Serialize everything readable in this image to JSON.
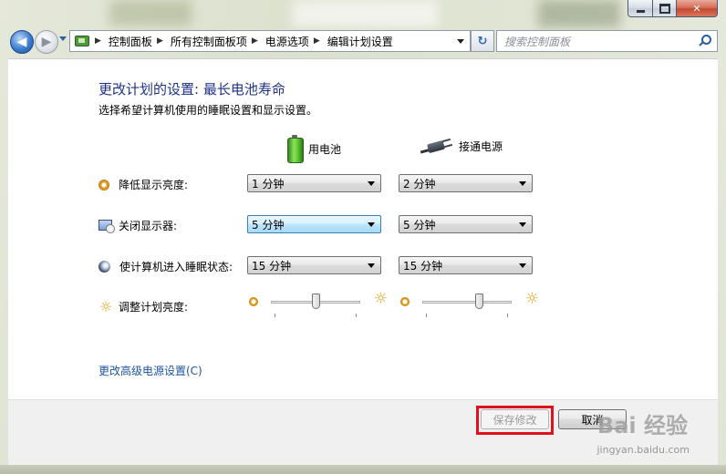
{
  "window": {
    "minimize_label": "",
    "maximize_label": "",
    "close_label": "✕"
  },
  "nav": {
    "back_label": "◀",
    "forward_label": "▶",
    "breadcrumbs": [
      "控制面板",
      "所有控制面板项",
      "电源选项",
      "编辑计划设置"
    ],
    "refresh_label": "↻",
    "search_placeholder": "搜索控制面板"
  },
  "page": {
    "title": "更改计划的设置: 最长电池寿命",
    "subtitle": "选择希望计算机使用的睡眠设置和显示设置。",
    "col_battery": "用电池",
    "col_plugged": "接通电源",
    "rows": [
      {
        "label": "降低显示亮度:",
        "icon": "dim-icon",
        "battery": "1 分钟",
        "plugged": "2 分钟"
      },
      {
        "label": "关闭显示器:",
        "icon": "display-off-icon",
        "battery": "5 分钟",
        "plugged": "5 分钟"
      },
      {
        "label": "使计算机进入睡眠状态:",
        "icon": "sleep-icon",
        "battery": "15 分钟",
        "plugged": "15 分钟"
      }
    ],
    "brightness_label": "调整计划亮度:",
    "brightness": {
      "battery": 0.5,
      "plugged": 0.65
    },
    "advanced_link": "更改高级电源设置(C)"
  },
  "footer": {
    "save_label": "保存修改",
    "cancel_label": "取消"
  },
  "watermark": {
    "brand": "Bai 经验",
    "url": "jingyan.baidu.com"
  },
  "colors": {
    "title": "#1e3287",
    "link": "#1e54a3",
    "highlight_box": "#e0101d"
  }
}
